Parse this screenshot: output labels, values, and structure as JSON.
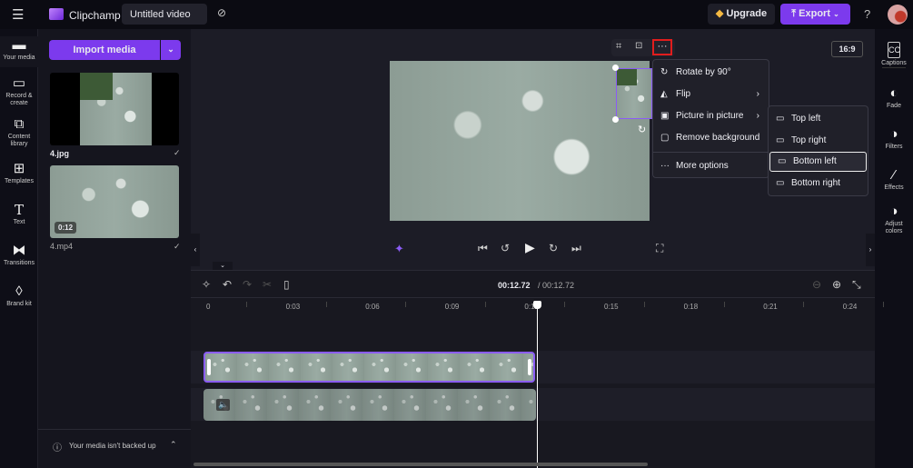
{
  "topbar": {
    "app_name": "Clipchamp",
    "project_title": "Untitled video",
    "upgrade": "Upgrade",
    "export": "Export",
    "help": "?"
  },
  "leftnav": [
    {
      "label": "Your media",
      "icon": "folder-icon"
    },
    {
      "label": "Record & create",
      "icon": "camera-icon"
    },
    {
      "label": "Content library",
      "icon": "library-icon"
    },
    {
      "label": "Templates",
      "icon": "templates-icon"
    },
    {
      "label": "Text",
      "icon": "text-icon"
    },
    {
      "label": "Transitions",
      "icon": "transitions-icon"
    },
    {
      "label": "Brand kit",
      "icon": "brand-kit-icon"
    }
  ],
  "media": {
    "import": "Import media",
    "items": [
      {
        "name": "4.jpg"
      },
      {
        "name": "4.mp4",
        "duration": "0:12"
      }
    ],
    "backup_notice": "Your media isn't backed up"
  },
  "preview": {
    "aspect": "16:9"
  },
  "context_menu": {
    "items": [
      "Rotate by 90°",
      "Flip",
      "Picture in picture",
      "Remove background",
      "More options"
    ]
  },
  "pip_submenu": {
    "items": [
      "Top left",
      "Top right",
      "Bottom left",
      "Bottom right"
    ],
    "selected": "Bottom left"
  },
  "rightnav": [
    {
      "label": "Captions",
      "icon": "captions-icon"
    },
    {
      "label": "Fade",
      "icon": "fade-icon"
    },
    {
      "label": "Filters",
      "icon": "filters-icon"
    },
    {
      "label": "Effects",
      "icon": "effects-icon"
    },
    {
      "label": "Adjust colors",
      "icon": "adjust-colors-icon"
    }
  ],
  "timeline": {
    "current": "00:12.72",
    "total": "/ 00:12.72",
    "ticks": [
      "0",
      "0:03",
      "0:06",
      "0:09",
      "0:12",
      "0:15",
      "0:18",
      "0:21",
      "0:24"
    ]
  },
  "colors": {
    "accent": "#7c3aed",
    "highlight": "#e11d1d"
  }
}
